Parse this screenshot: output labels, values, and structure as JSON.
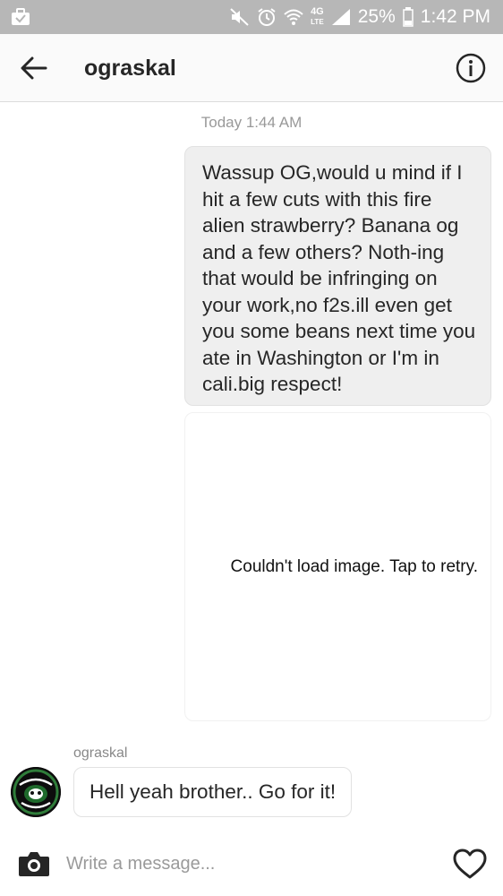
{
  "status_bar": {
    "battery_percent": "25%",
    "time": "1:42 PM",
    "network": "4G",
    "network_sub": "LTE"
  },
  "header": {
    "title": "ograskal"
  },
  "thread": {
    "timestamp": "Today 1:44 AM",
    "outgoing_message": "Wassup OG,would u mind if I hit a few cuts with this fire alien strawberry? Banana og and a few others? Noth-ing that would be infringing on your work,no f2s.ill even get you some beans next time you ate in Washington or I'm in cali.big respect!",
    "image_error": "Couldn't load image. Tap to retry.",
    "sender_name": "ograskal",
    "incoming_message": "Hell yeah brother.. Go for it!"
  },
  "composer": {
    "placeholder": "Write a message..."
  },
  "colors": {
    "status_bar_bg": "#b7b7b7",
    "bubble_out_bg": "#efefef",
    "text": "#262626",
    "muted": "#999999"
  },
  "icons": {
    "back": "arrow-left-icon",
    "info": "info-icon",
    "camera": "camera-icon",
    "heart": "heart-icon"
  }
}
